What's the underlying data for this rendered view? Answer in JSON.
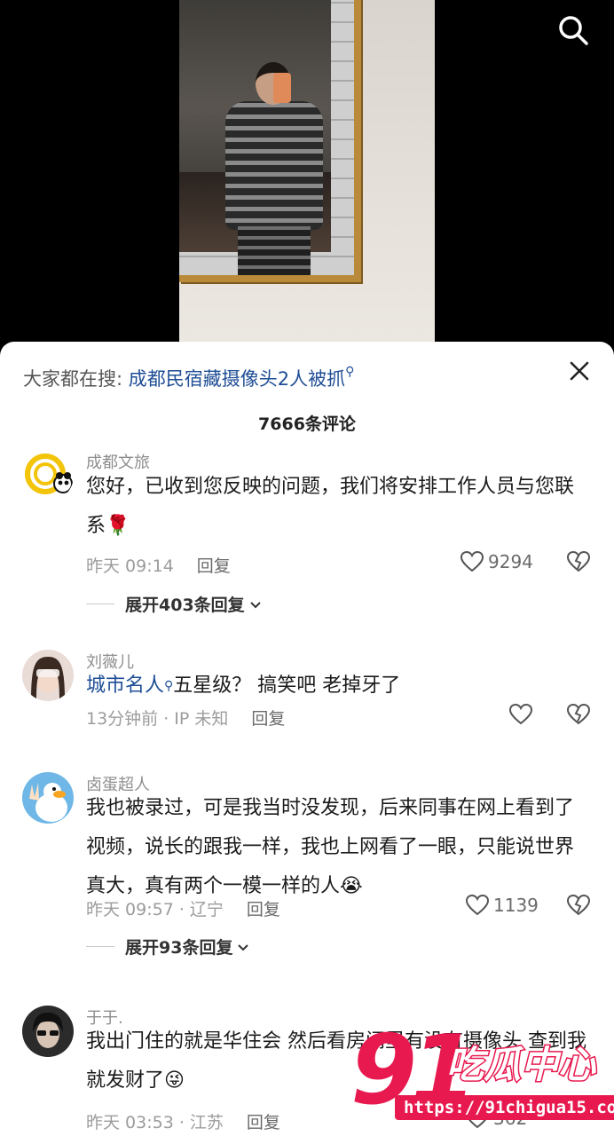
{
  "hot_search": {
    "prefix": "大家都在搜:",
    "term": "成都民宿藏摄像头2人被抓",
    "search_glyph": "⚲"
  },
  "comment_count": "7666条评论",
  "comments": [
    {
      "username": "成都文旅",
      "text": "您好，已收到您反映的问题，我们将安排工作人员与您联系",
      "emoji": "🌹",
      "time": "昨天 09:14",
      "reply_label": "回复",
      "likes": "9294",
      "expand_label": "展开403条回复"
    },
    {
      "username": "刘薇儿",
      "tag": "城市名人",
      "tag_glyph": "⚲",
      "text": "五星级？ 搞笑吧 老掉牙了",
      "time": "13分钟前 · IP 未知",
      "reply_label": "回复"
    },
    {
      "username": "卤蛋超人",
      "text": "我也被录过，可是我当时没发现，后来同事在网上看到了视频，说长的跟我一样，我也上网看了一眼，只能说世界真大，真有两个一模一样的人",
      "emoji": "😭",
      "time": "昨天 09:57 · 辽宁",
      "reply_label": "回复",
      "likes": "1139",
      "expand_label": "展开93条回复"
    },
    {
      "username": "于于.",
      "text": "我出门住的就是华住会 然后看房间里有没有摄像头 查到我就发财了",
      "emoji": "😜",
      "time": "昨天 03:53 · 江苏",
      "reply_label": "回复",
      "likes": "362"
    }
  ],
  "watermark": {
    "number": "91",
    "name": "吃瓜中心",
    "url": "https://91chigua15.com"
  },
  "colors": {
    "accent_link": "#1f4e96",
    "watermark": "#e8194f"
  },
  "icons": [
    "search-icon",
    "close-icon",
    "heart-icon",
    "broken-heart-icon",
    "chevron-down-icon"
  ]
}
